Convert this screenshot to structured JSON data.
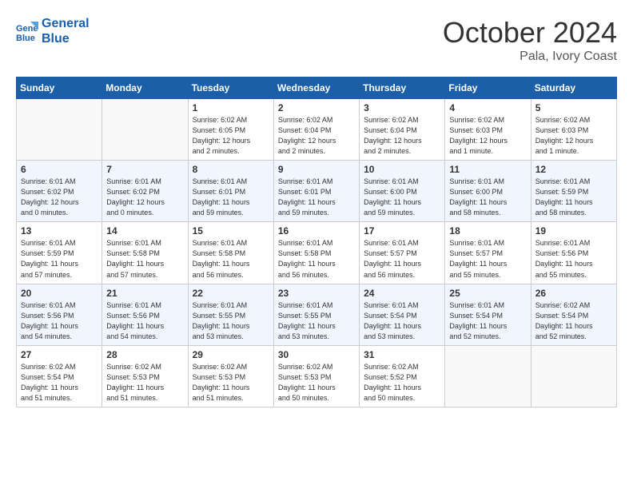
{
  "logo": {
    "line1": "General",
    "line2": "Blue"
  },
  "title": "October 2024",
  "location": "Pala, Ivory Coast",
  "days_of_week": [
    "Sunday",
    "Monday",
    "Tuesday",
    "Wednesday",
    "Thursday",
    "Friday",
    "Saturday"
  ],
  "weeks": [
    [
      {
        "day": "",
        "info": ""
      },
      {
        "day": "",
        "info": ""
      },
      {
        "day": "1",
        "info": "Sunrise: 6:02 AM\nSunset: 6:05 PM\nDaylight: 12 hours\nand 2 minutes."
      },
      {
        "day": "2",
        "info": "Sunrise: 6:02 AM\nSunset: 6:04 PM\nDaylight: 12 hours\nand 2 minutes."
      },
      {
        "day": "3",
        "info": "Sunrise: 6:02 AM\nSunset: 6:04 PM\nDaylight: 12 hours\nand 2 minutes."
      },
      {
        "day": "4",
        "info": "Sunrise: 6:02 AM\nSunset: 6:03 PM\nDaylight: 12 hours\nand 1 minute."
      },
      {
        "day": "5",
        "info": "Sunrise: 6:02 AM\nSunset: 6:03 PM\nDaylight: 12 hours\nand 1 minute."
      }
    ],
    [
      {
        "day": "6",
        "info": "Sunrise: 6:01 AM\nSunset: 6:02 PM\nDaylight: 12 hours\nand 0 minutes."
      },
      {
        "day": "7",
        "info": "Sunrise: 6:01 AM\nSunset: 6:02 PM\nDaylight: 12 hours\nand 0 minutes."
      },
      {
        "day": "8",
        "info": "Sunrise: 6:01 AM\nSunset: 6:01 PM\nDaylight: 11 hours\nand 59 minutes."
      },
      {
        "day": "9",
        "info": "Sunrise: 6:01 AM\nSunset: 6:01 PM\nDaylight: 11 hours\nand 59 minutes."
      },
      {
        "day": "10",
        "info": "Sunrise: 6:01 AM\nSunset: 6:00 PM\nDaylight: 11 hours\nand 59 minutes."
      },
      {
        "day": "11",
        "info": "Sunrise: 6:01 AM\nSunset: 6:00 PM\nDaylight: 11 hours\nand 58 minutes."
      },
      {
        "day": "12",
        "info": "Sunrise: 6:01 AM\nSunset: 5:59 PM\nDaylight: 11 hours\nand 58 minutes."
      }
    ],
    [
      {
        "day": "13",
        "info": "Sunrise: 6:01 AM\nSunset: 5:59 PM\nDaylight: 11 hours\nand 57 minutes."
      },
      {
        "day": "14",
        "info": "Sunrise: 6:01 AM\nSunset: 5:58 PM\nDaylight: 11 hours\nand 57 minutes."
      },
      {
        "day": "15",
        "info": "Sunrise: 6:01 AM\nSunset: 5:58 PM\nDaylight: 11 hours\nand 56 minutes."
      },
      {
        "day": "16",
        "info": "Sunrise: 6:01 AM\nSunset: 5:58 PM\nDaylight: 11 hours\nand 56 minutes."
      },
      {
        "day": "17",
        "info": "Sunrise: 6:01 AM\nSunset: 5:57 PM\nDaylight: 11 hours\nand 56 minutes."
      },
      {
        "day": "18",
        "info": "Sunrise: 6:01 AM\nSunset: 5:57 PM\nDaylight: 11 hours\nand 55 minutes."
      },
      {
        "day": "19",
        "info": "Sunrise: 6:01 AM\nSunset: 5:56 PM\nDaylight: 11 hours\nand 55 minutes."
      }
    ],
    [
      {
        "day": "20",
        "info": "Sunrise: 6:01 AM\nSunset: 5:56 PM\nDaylight: 11 hours\nand 54 minutes."
      },
      {
        "day": "21",
        "info": "Sunrise: 6:01 AM\nSunset: 5:56 PM\nDaylight: 11 hours\nand 54 minutes."
      },
      {
        "day": "22",
        "info": "Sunrise: 6:01 AM\nSunset: 5:55 PM\nDaylight: 11 hours\nand 53 minutes."
      },
      {
        "day": "23",
        "info": "Sunrise: 6:01 AM\nSunset: 5:55 PM\nDaylight: 11 hours\nand 53 minutes."
      },
      {
        "day": "24",
        "info": "Sunrise: 6:01 AM\nSunset: 5:54 PM\nDaylight: 11 hours\nand 53 minutes."
      },
      {
        "day": "25",
        "info": "Sunrise: 6:01 AM\nSunset: 5:54 PM\nDaylight: 11 hours\nand 52 minutes."
      },
      {
        "day": "26",
        "info": "Sunrise: 6:02 AM\nSunset: 5:54 PM\nDaylight: 11 hours\nand 52 minutes."
      }
    ],
    [
      {
        "day": "27",
        "info": "Sunrise: 6:02 AM\nSunset: 5:54 PM\nDaylight: 11 hours\nand 51 minutes."
      },
      {
        "day": "28",
        "info": "Sunrise: 6:02 AM\nSunset: 5:53 PM\nDaylight: 11 hours\nand 51 minutes."
      },
      {
        "day": "29",
        "info": "Sunrise: 6:02 AM\nSunset: 5:53 PM\nDaylight: 11 hours\nand 51 minutes."
      },
      {
        "day": "30",
        "info": "Sunrise: 6:02 AM\nSunset: 5:53 PM\nDaylight: 11 hours\nand 50 minutes."
      },
      {
        "day": "31",
        "info": "Sunrise: 6:02 AM\nSunset: 5:52 PM\nDaylight: 11 hours\nand 50 minutes."
      },
      {
        "day": "",
        "info": ""
      },
      {
        "day": "",
        "info": ""
      }
    ]
  ]
}
